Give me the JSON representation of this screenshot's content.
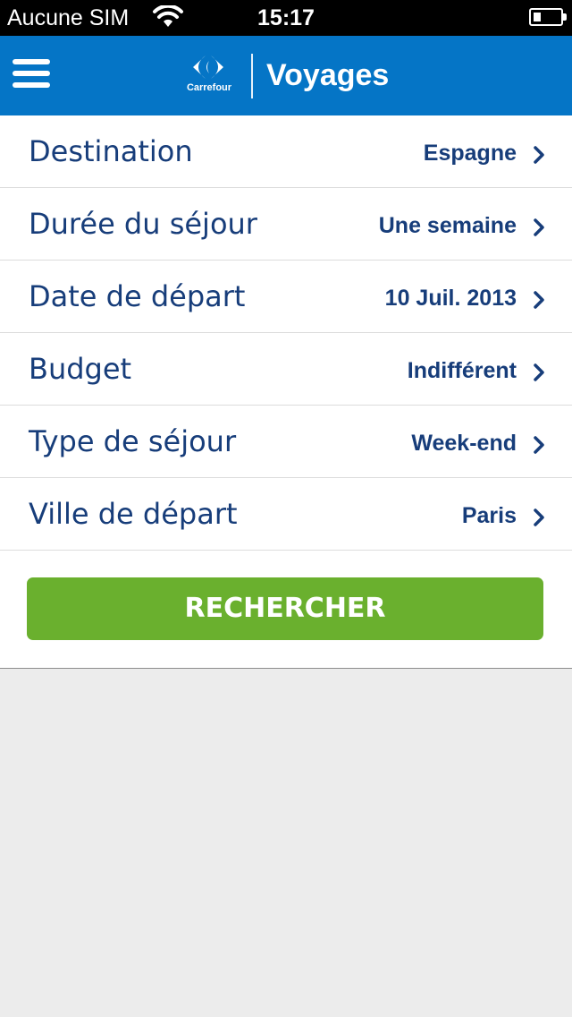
{
  "status_bar": {
    "carrier": "Aucune SIM",
    "time": "15:17",
    "wifi_icon": "wifi-icon",
    "battery_icon": "battery-icon"
  },
  "nav": {
    "menu_icon": "hamburger-menu-icon",
    "logo_text": "Carrefour",
    "title": "Voyages",
    "background_color": "#0575c6"
  },
  "form": {
    "rows": [
      {
        "label": "Destination",
        "value": "Espagne"
      },
      {
        "label": "Durée du séjour",
        "value": "Une semaine"
      },
      {
        "label": "Date de départ",
        "value": "10 Juil. 2013"
      },
      {
        "label": "Budget",
        "value": "Indifférent"
      },
      {
        "label": "Type de séjour",
        "value": "Week-end"
      },
      {
        "label": "Ville de départ",
        "value": "Paris"
      }
    ],
    "search_label": "RECHERCHER",
    "search_color": "#6ab02e",
    "text_color": "#173d7a"
  }
}
